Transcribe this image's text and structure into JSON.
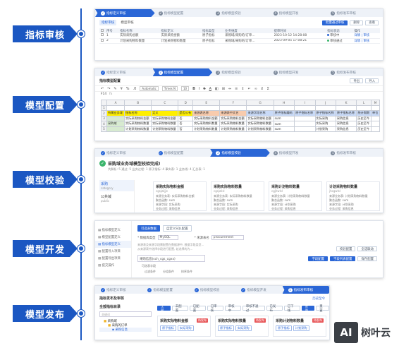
{
  "stages": [
    {
      "label": "指标审核"
    },
    {
      "label": "模型配置"
    },
    {
      "label": "模型校验"
    },
    {
      "label": "模型开发"
    },
    {
      "label": "模型发布"
    }
  ],
  "steps": [
    "指标定义审核",
    "指标模型配置",
    "指标模型校验",
    "指标模型开发",
    "指标发布审核"
  ],
  "review": {
    "tabs": [
      "指标审核",
      "模型审核"
    ],
    "buttons": [
      "批量通过审核",
      "删除",
      "查看"
    ],
    "columns": [
      "",
      "序号",
      "指标名称",
      "指标定义",
      "指标类型",
      "业务维度",
      "提审时间",
      "指标状态",
      "操作"
    ],
    "rows": [
      [
        "1",
        "实际采购总额",
        "实际采购金额",
        "原子指标",
        "采购域/采购的/订单…",
        "2023-10-12 14:28:08",
        "审核中",
        "详情 | 审核"
      ],
      [
        "2",
        "计划采购物料数量",
        "计划采购物料数量",
        "原子指标",
        "采购域/采购的/订单…",
        "2023-09-05 17:08:21",
        "审核通过",
        "详情 | 审核"
      ]
    ],
    "status_colors": [
      "#2a66d6",
      "#3bb56c"
    ]
  },
  "config": {
    "title": "指标模型配置",
    "buttons": [
      "导出",
      "导入"
    ],
    "font_name": "Times N",
    "font_size": "10",
    "zoom": "Automatic",
    "cell_ref": "F14",
    "col_headers": [
      "A",
      "B",
      "C",
      "D",
      "E",
      "F",
      "G",
      "H",
      "I",
      "J",
      "K",
      "L",
      "M"
    ],
    "rows": [
      [
        "1",
        "",
        "",
        "",
        "",
        "",
        "",
        "",
        "",
        "",
        "",
        "",
        "",
        ""
      ],
      [
        "2",
        "所属业务域",
        "指标名称",
        "定义",
        "是否公有",
        "来源表名称",
        "来源表中文名",
        "来源字段名称",
        "原子指标编码",
        "原子指标名称",
        "原子指标名称",
        "原子指标名称",
        "统计周期",
        "单位"
      ],
      [
        "3",
        "",
        "实际采购物料金额",
        "实际采购物料金额",
        "否",
        "实际采购物料金额",
        "实际采购物料金额",
        "实际采购物料金额",
        "sum",
        "",
        "实际采购",
        "采购信息",
        "历史至今",
        ""
      ],
      [
        "4",
        "采购域",
        "实际采购物料数量",
        "实际采购物料数量",
        "否",
        "实际采购物料数量",
        "实际采购物料数量",
        "实际采购物料数量",
        "sum",
        "",
        "实际采购",
        "采购信息",
        "历史至今",
        ""
      ],
      [
        "5",
        "",
        "计划采购物料数量",
        "计划采购物料数量",
        "否",
        "计划采购物料数量",
        "计划采购物料数量",
        "计划采购物料数量",
        "sum",
        "",
        "计划采购",
        "采购信息",
        "历史至今",
        ""
      ]
    ]
  },
  "check": {
    "title": "采购域业务域模型校验完成!",
    "summary": "共解析: 5  通过: 5  业务过程: 1  原子指标: 4  事实表: 1  业务线: 4  汇总表: 1",
    "left_items": [
      {
        "name": "采购",
        "sub": "category"
      },
      {
        "name": "公共域",
        "sub": "public"
      }
    ],
    "cards": [
      {
        "title": "采购实际物料金额",
        "code": "cgsjwljje",
        "kv": [
          "来源业务表: 实际采购物料金额",
          "聚合函数: sum",
          "来源字段: 实际采购",
          "业务过程: 采购信息"
        ]
      },
      {
        "title": "采购实际物料数量",
        "code": "cgsjwlsl",
        "kv": [
          "来源业务表: 实际采购物料数量",
          "聚合函数: sum",
          "来源字段: 实际采购",
          "业务过程: 采购信息"
        ]
      },
      {
        "title": "采购计划物料数量",
        "code": "cgjhwlsl",
        "kv": [
          "来源业务表: 计划采购物料数量",
          "聚合函数: sum",
          "来源字段: 计划采购",
          "业务过程: 采购信息"
        ]
      },
      {
        "title": "计划采购物料数量",
        "code": "jhcgwlsl",
        "kv": [
          "来源业务表: 计划采购物料数量",
          "聚合函数: sum",
          "来源字段: 计划采购",
          "业务过程: 采购信息"
        ]
      }
    ]
  },
  "dev": {
    "side": [
      "指标模型定义",
      "模型配置定义",
      "指标模型定义",
      "配置导入项目",
      "配置导出项目",
      "提交操作"
    ],
    "tabs": [
      "可选表数据",
      "自定义SQL配置"
    ],
    "db_label": "* 数据库类型",
    "db_value": "MySQL",
    "table_label": "* 来源表名",
    "table_value": "procurement",
    "note": "来源表及来源字段需配置在数据源中, 根据字段类型...",
    "note2": "从来源表中选择字段进行配置, 若选择的为...",
    "buttons": [
      "校验配置",
      "全选联动"
    ],
    "source_table": "采购信息(sch_cgs_cgxx)",
    "sub": "可选表字段",
    "fields": [
      "过滤条件",
      "分组条件",
      "排序条件"
    ],
    "actions": [
      "字段配置",
      "字段列表配置",
      "保存配置"
    ]
  },
  "publish": {
    "title": "指标发布及审核",
    "period": "历史至今",
    "catalog_title": "全部指标目录",
    "search_placeholder": "关键词",
    "tree": [
      "采购域",
      "采购的订单",
      "采购信息"
    ],
    "filter_tabs": [
      "全部",
      "未配置",
      "已配置",
      "已审核",
      "审核中",
      "审核不通过",
      "已发布",
      "已下线"
    ],
    "buttons": [
      "查询",
      "重置"
    ],
    "cards": [
      {
        "title": "采购实际物料金额",
        "tag": "待发布",
        "pills": [
          "原子指标",
          "实际采购"
        ]
      },
      {
        "title": "采购实际物料数量",
        "tag": "待发布",
        "pills": [
          "原子指标",
          "实际采购"
        ]
      },
      {
        "title": "采购计划物料数量",
        "tag": "待发布",
        "pills": [
          "原子指标",
          "计划采购"
        ]
      }
    ]
  },
  "brand": {
    "box": "AI",
    "name": "树叶云"
  }
}
